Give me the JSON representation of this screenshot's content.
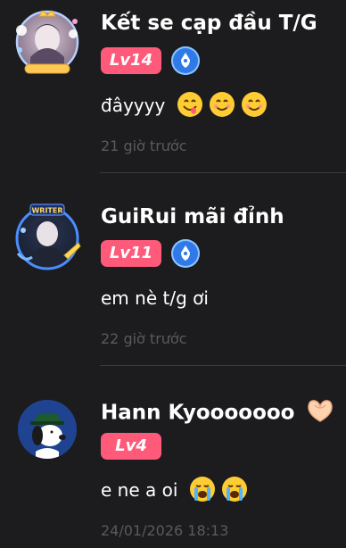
{
  "comments": [
    {
      "username": "Kết se cạp đầu T/G",
      "level": "Lv14",
      "verified": true,
      "text": "đâyyyy",
      "emojis": [
        "face-savoring-food",
        "smiling-face",
        "smiling-face"
      ],
      "timestamp": "21 giờ trước"
    },
    {
      "username": "GuiRui mãi đỉnh",
      "level": "Lv11",
      "verified": true,
      "frame_label": "WRITER",
      "text": "em nè t/g ơi",
      "timestamp": "22 giờ trước"
    },
    {
      "username": "Hann Kyooooooo",
      "username_emoji": "heart-hands",
      "level": "Lv4",
      "verified": false,
      "text": "e ne a oi",
      "emojis": [
        "loudly-crying-face",
        "loudly-crying-face"
      ],
      "timestamp": "24/01/2026 18:13"
    }
  ],
  "colors": {
    "background": "#1c1c1e",
    "level_badge": "#ff5a7a",
    "verify_badge": "#2f7ae8",
    "timestamp": "#5a5a5e",
    "divider": "#3a3a3c"
  }
}
